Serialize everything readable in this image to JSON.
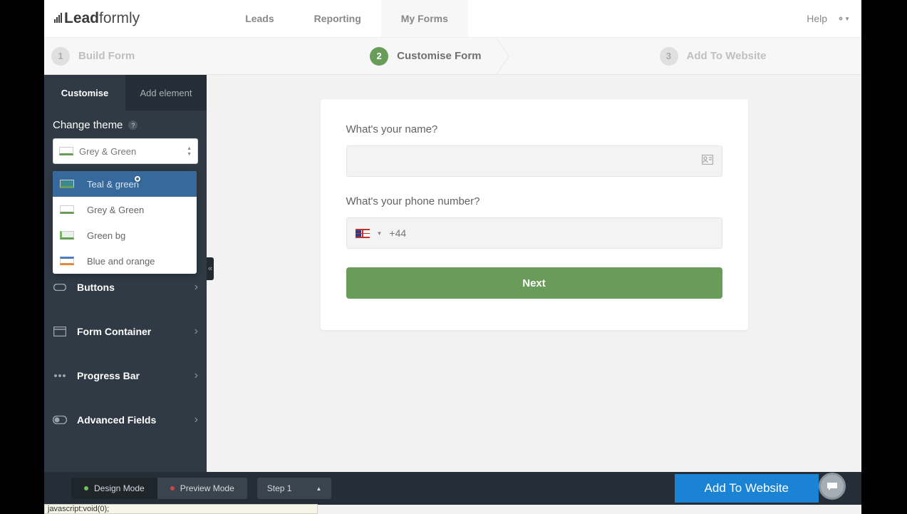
{
  "header": {
    "logo_bold": "Lead",
    "logo_light": "formly",
    "nav": [
      "Leads",
      "Reporting",
      "My Forms"
    ],
    "nav_active": 2,
    "help": "Help"
  },
  "steps": [
    {
      "num": "1",
      "label": "Build Form",
      "active": false
    },
    {
      "num": "2",
      "label": "Customise Form",
      "active": true
    },
    {
      "num": "3",
      "label": "Add To Website",
      "active": false
    }
  ],
  "sidebar": {
    "tabs": [
      "Customise",
      "Add element"
    ],
    "tab_active": 0,
    "change_theme_label": "Change theme",
    "theme_selected": "Grey & Green",
    "dropdown": [
      {
        "label": "Teal & green",
        "selected": true
      },
      {
        "label": "Grey & Green",
        "selected": false
      },
      {
        "label": "Green bg",
        "selected": false
      },
      {
        "label": "Blue and orange",
        "selected": false
      }
    ],
    "items": [
      {
        "label": "Buttons"
      },
      {
        "label": "Form Container"
      },
      {
        "label": "Progress Bar"
      },
      {
        "label": "Advanced Fields"
      }
    ]
  },
  "form": {
    "q1": "What's your name?",
    "q2": "What's your phone number?",
    "phone_prefix": "+44",
    "next": "Next"
  },
  "bottom": {
    "design": "Design Mode",
    "preview": "Preview Mode",
    "step": "Step 1",
    "add_to_website": "Add To Website"
  },
  "status": "javascript:void(0);"
}
